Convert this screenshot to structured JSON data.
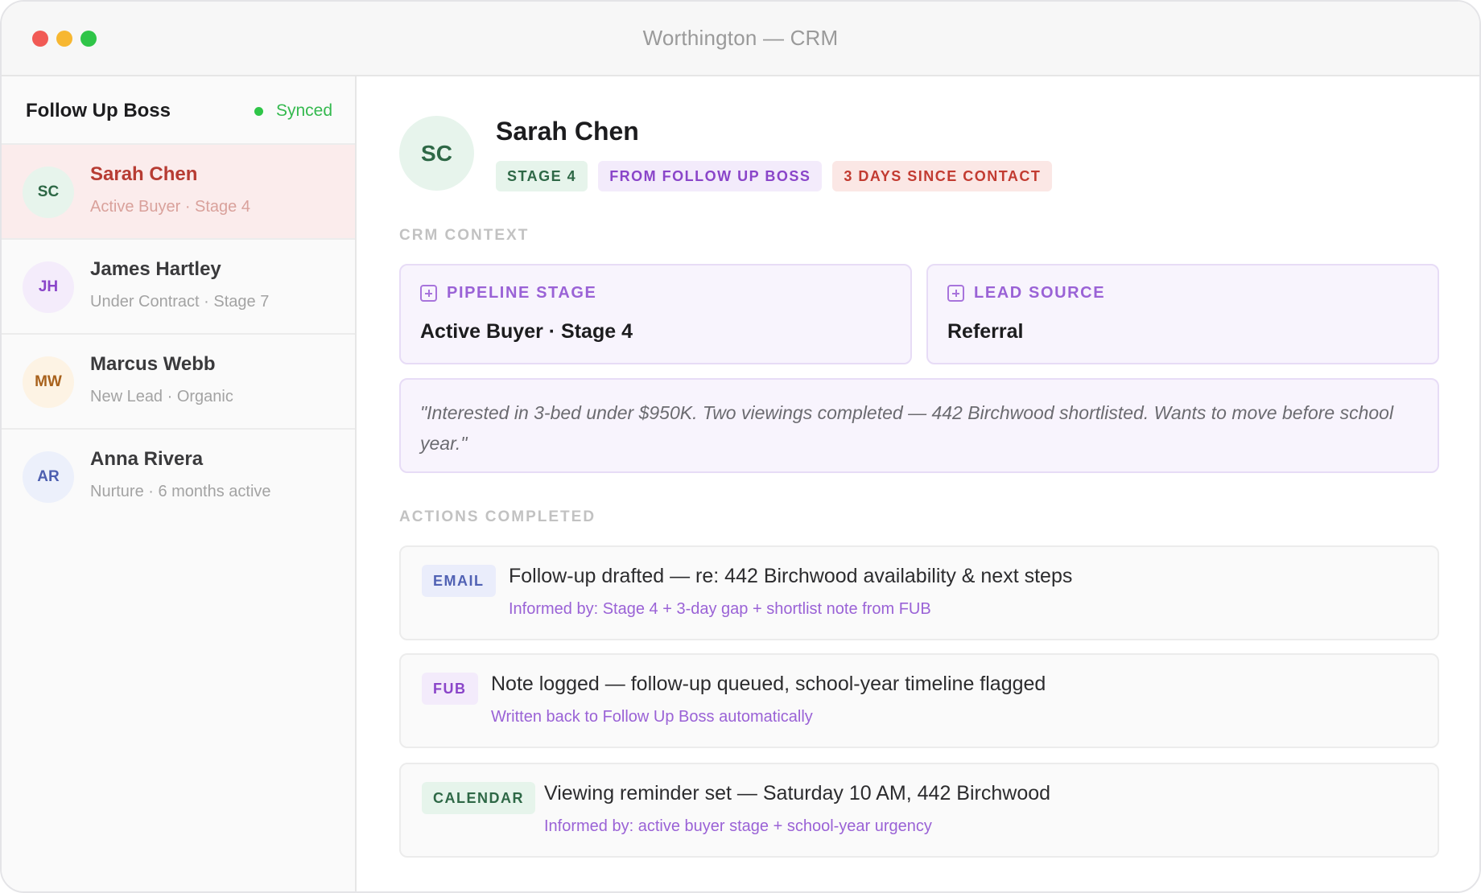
{
  "window": {
    "title": "Worthington — CRM"
  },
  "sidebar": {
    "title": "Follow Up Boss",
    "sync_status": "Synced",
    "contacts": [
      {
        "initials": "SC",
        "name": "Sarah Chen",
        "subtitle": "Active Buyer · Stage 4",
        "active": true,
        "avatar_bg": "#e7f4ec",
        "avatar_color": "#2e6846"
      },
      {
        "initials": "JH",
        "name": "James Hartley",
        "subtitle": "Under Contract · Stage 7",
        "active": false,
        "avatar_bg": "#f4ecfb",
        "avatar_color": "#8a45c9"
      },
      {
        "initials": "MW",
        "name": "Marcus Webb",
        "subtitle": "New Lead · Organic",
        "active": false,
        "avatar_bg": "#fdf3e4",
        "avatar_color": "#a8611c"
      },
      {
        "initials": "AR",
        "name": "Anna Rivera",
        "subtitle": "Nurture · 6 months active",
        "active": false,
        "avatar_bg": "#ecf0fb",
        "avatar_color": "#4d5fb0"
      }
    ]
  },
  "profile": {
    "initials": "SC",
    "name": "Sarah Chen",
    "badges": {
      "stage": "STAGE 4",
      "source": "FROM FOLLOW UP BOSS",
      "contact": "3 DAYS SINCE CONTACT"
    }
  },
  "crm_context": {
    "label": "CRM CONTEXT",
    "pipeline": {
      "label": "PIPELINE STAGE",
      "value": "Active Buyer · Stage 4"
    },
    "lead_source": {
      "label": "LEAD SOURCE",
      "value": "Referral"
    },
    "note": "\"Interested in 3-bed under $950K. Two viewings completed — 442 Birchwood shortlisted. Wants to move before school year.\""
  },
  "actions": {
    "label": "ACTIONS COMPLETED",
    "items": [
      {
        "tag": "EMAIL",
        "title": "Follow-up drafted — re: 442 Birchwood availability & next steps",
        "subtitle": "Informed by: Stage 4 + 3-day gap + shortlist note from FUB"
      },
      {
        "tag": "FUB",
        "title": "Note logged — follow-up queued, school-year timeline flagged",
        "subtitle": "Written back to Follow Up Boss automatically"
      },
      {
        "tag": "CALENDAR",
        "title": "Viewing reminder set — Saturday 10 AM, 442 Birchwood",
        "subtitle": "Informed by: active buyer stage + school-year urgency"
      }
    ]
  },
  "colors": {
    "accent_purple": "#9a62d6",
    "active_red": "#b73c33",
    "synced_green": "#2fc548"
  }
}
